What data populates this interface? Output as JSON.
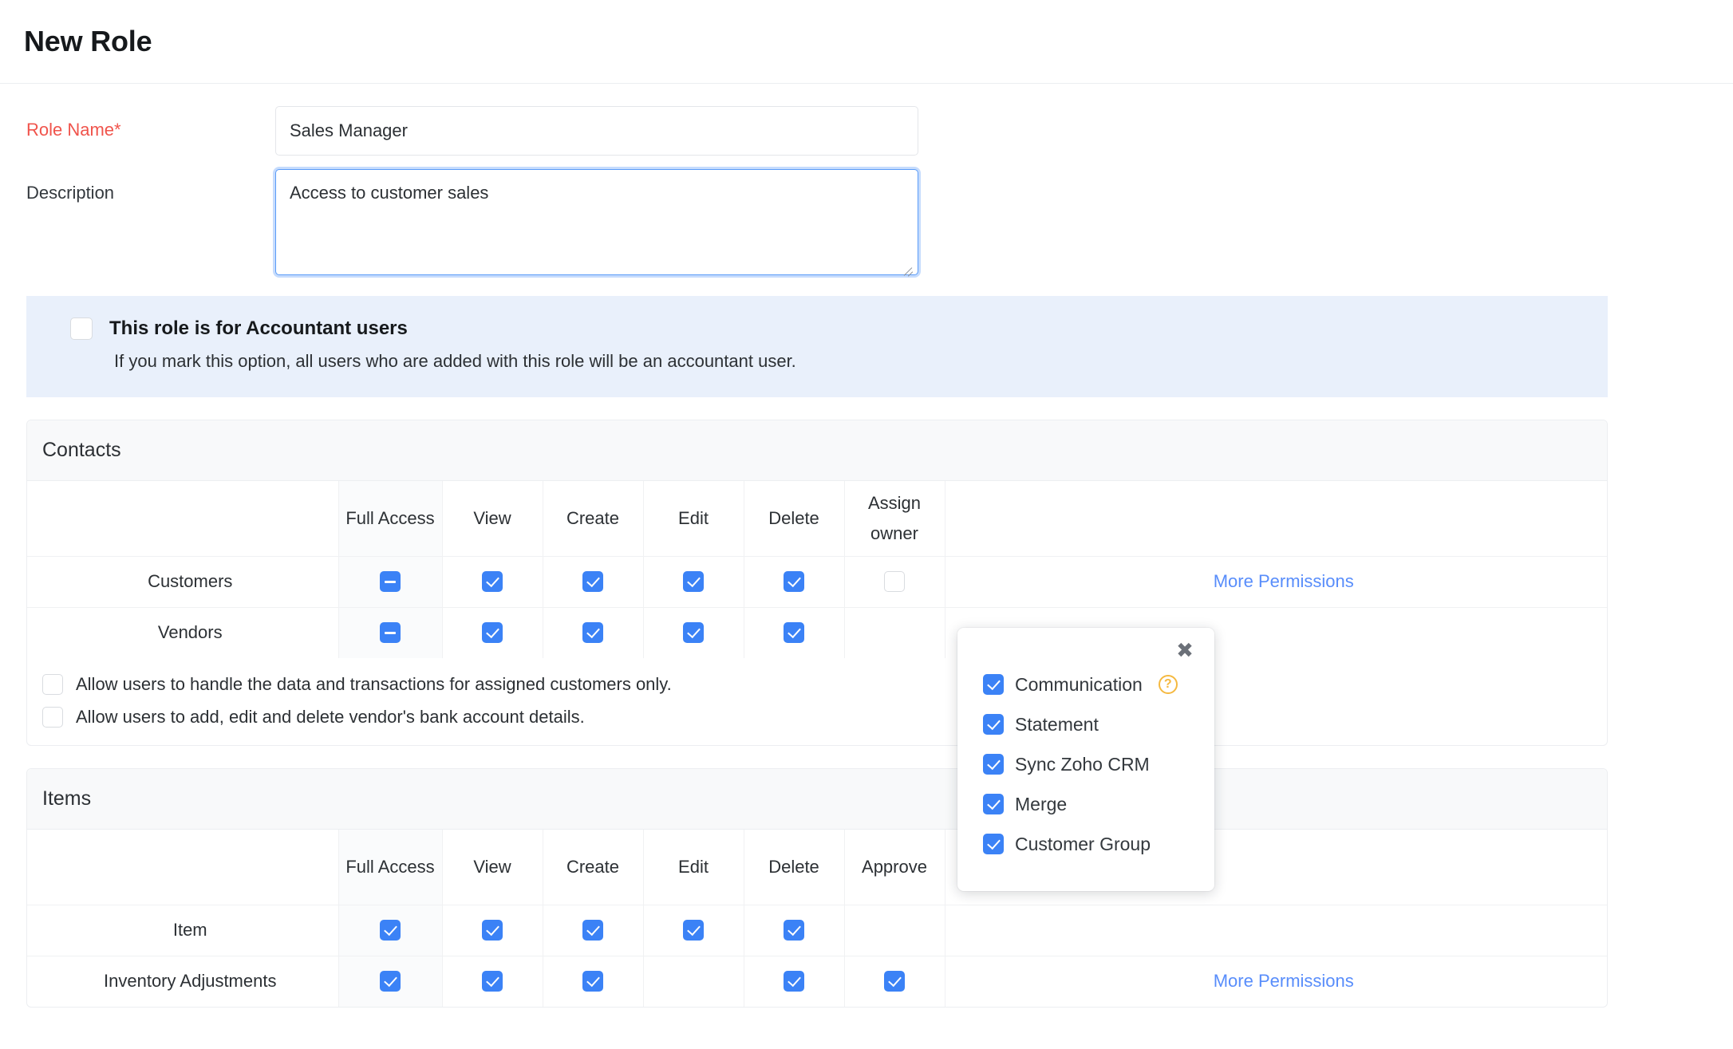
{
  "header": {
    "title": "New Role"
  },
  "form": {
    "role_name": {
      "label": "Role Name*",
      "value": "Sales Manager",
      "placeholder": ""
    },
    "description": {
      "label": "Description",
      "value": "Access to customer sales",
      "placeholder": ""
    }
  },
  "accountant_banner": {
    "title": "This role is for Accountant users",
    "subtitle": "If you mark this option, all users who are added with this role will be an accountant user.",
    "checked": false,
    "background": "#e9f0fb"
  },
  "sections": [
    {
      "title": "Contacts",
      "columns": [
        "",
        "Full Access",
        "View",
        "Create",
        "Edit",
        "Delete",
        "Assign owner",
        ""
      ],
      "rows": [
        {
          "name": "Customers",
          "full_access": "indeterminate",
          "view": "checked",
          "create": "checked",
          "edit": "checked",
          "delete": "checked",
          "last": "empty",
          "more_link": "More Permissions"
        },
        {
          "name": "Vendors",
          "full_access": "indeterminate",
          "view": "checked",
          "create": "checked",
          "edit": "checked",
          "delete": "checked",
          "last": "none",
          "more_link": ""
        }
      ],
      "notes": [
        {
          "text": "Allow users to handle the data and transactions for assigned customers only.",
          "checked": false
        },
        {
          "text": "Allow users to add, edit and delete vendor's bank account details.",
          "checked": false
        }
      ]
    },
    {
      "title": "Items",
      "columns": [
        "",
        "Full Access",
        "View",
        "Create",
        "Edit",
        "Delete",
        "Approve",
        ""
      ],
      "rows": [
        {
          "name": "Item",
          "full_access": "checked",
          "view": "checked",
          "create": "checked",
          "edit": "checked",
          "delete": "checked",
          "last": "none",
          "more_link": ""
        },
        {
          "name": "Inventory Adjustments",
          "full_access": "checked",
          "view": "checked",
          "create": "checked",
          "edit": "none",
          "delete": "checked",
          "last": "checked",
          "more_link": "More Permissions"
        }
      ],
      "notes": []
    }
  ],
  "popup": {
    "close_label": "✖",
    "items": [
      {
        "label": "Communication",
        "checked": true,
        "help": true
      },
      {
        "label": "Statement",
        "checked": true,
        "help": false
      },
      {
        "label": "Sync Zoho CRM",
        "checked": true,
        "help": false
      },
      {
        "label": "Merge",
        "checked": true,
        "help": false
      },
      {
        "label": "Customer Group",
        "checked": true,
        "help": false
      }
    ],
    "help_glyph": "?"
  },
  "colors": {
    "accent_blue": "#3b82f6",
    "link_blue": "#588dfb",
    "required_red": "#f0544c",
    "banner_blue": "#e9f0fb",
    "help_amber": "#f5b940"
  }
}
